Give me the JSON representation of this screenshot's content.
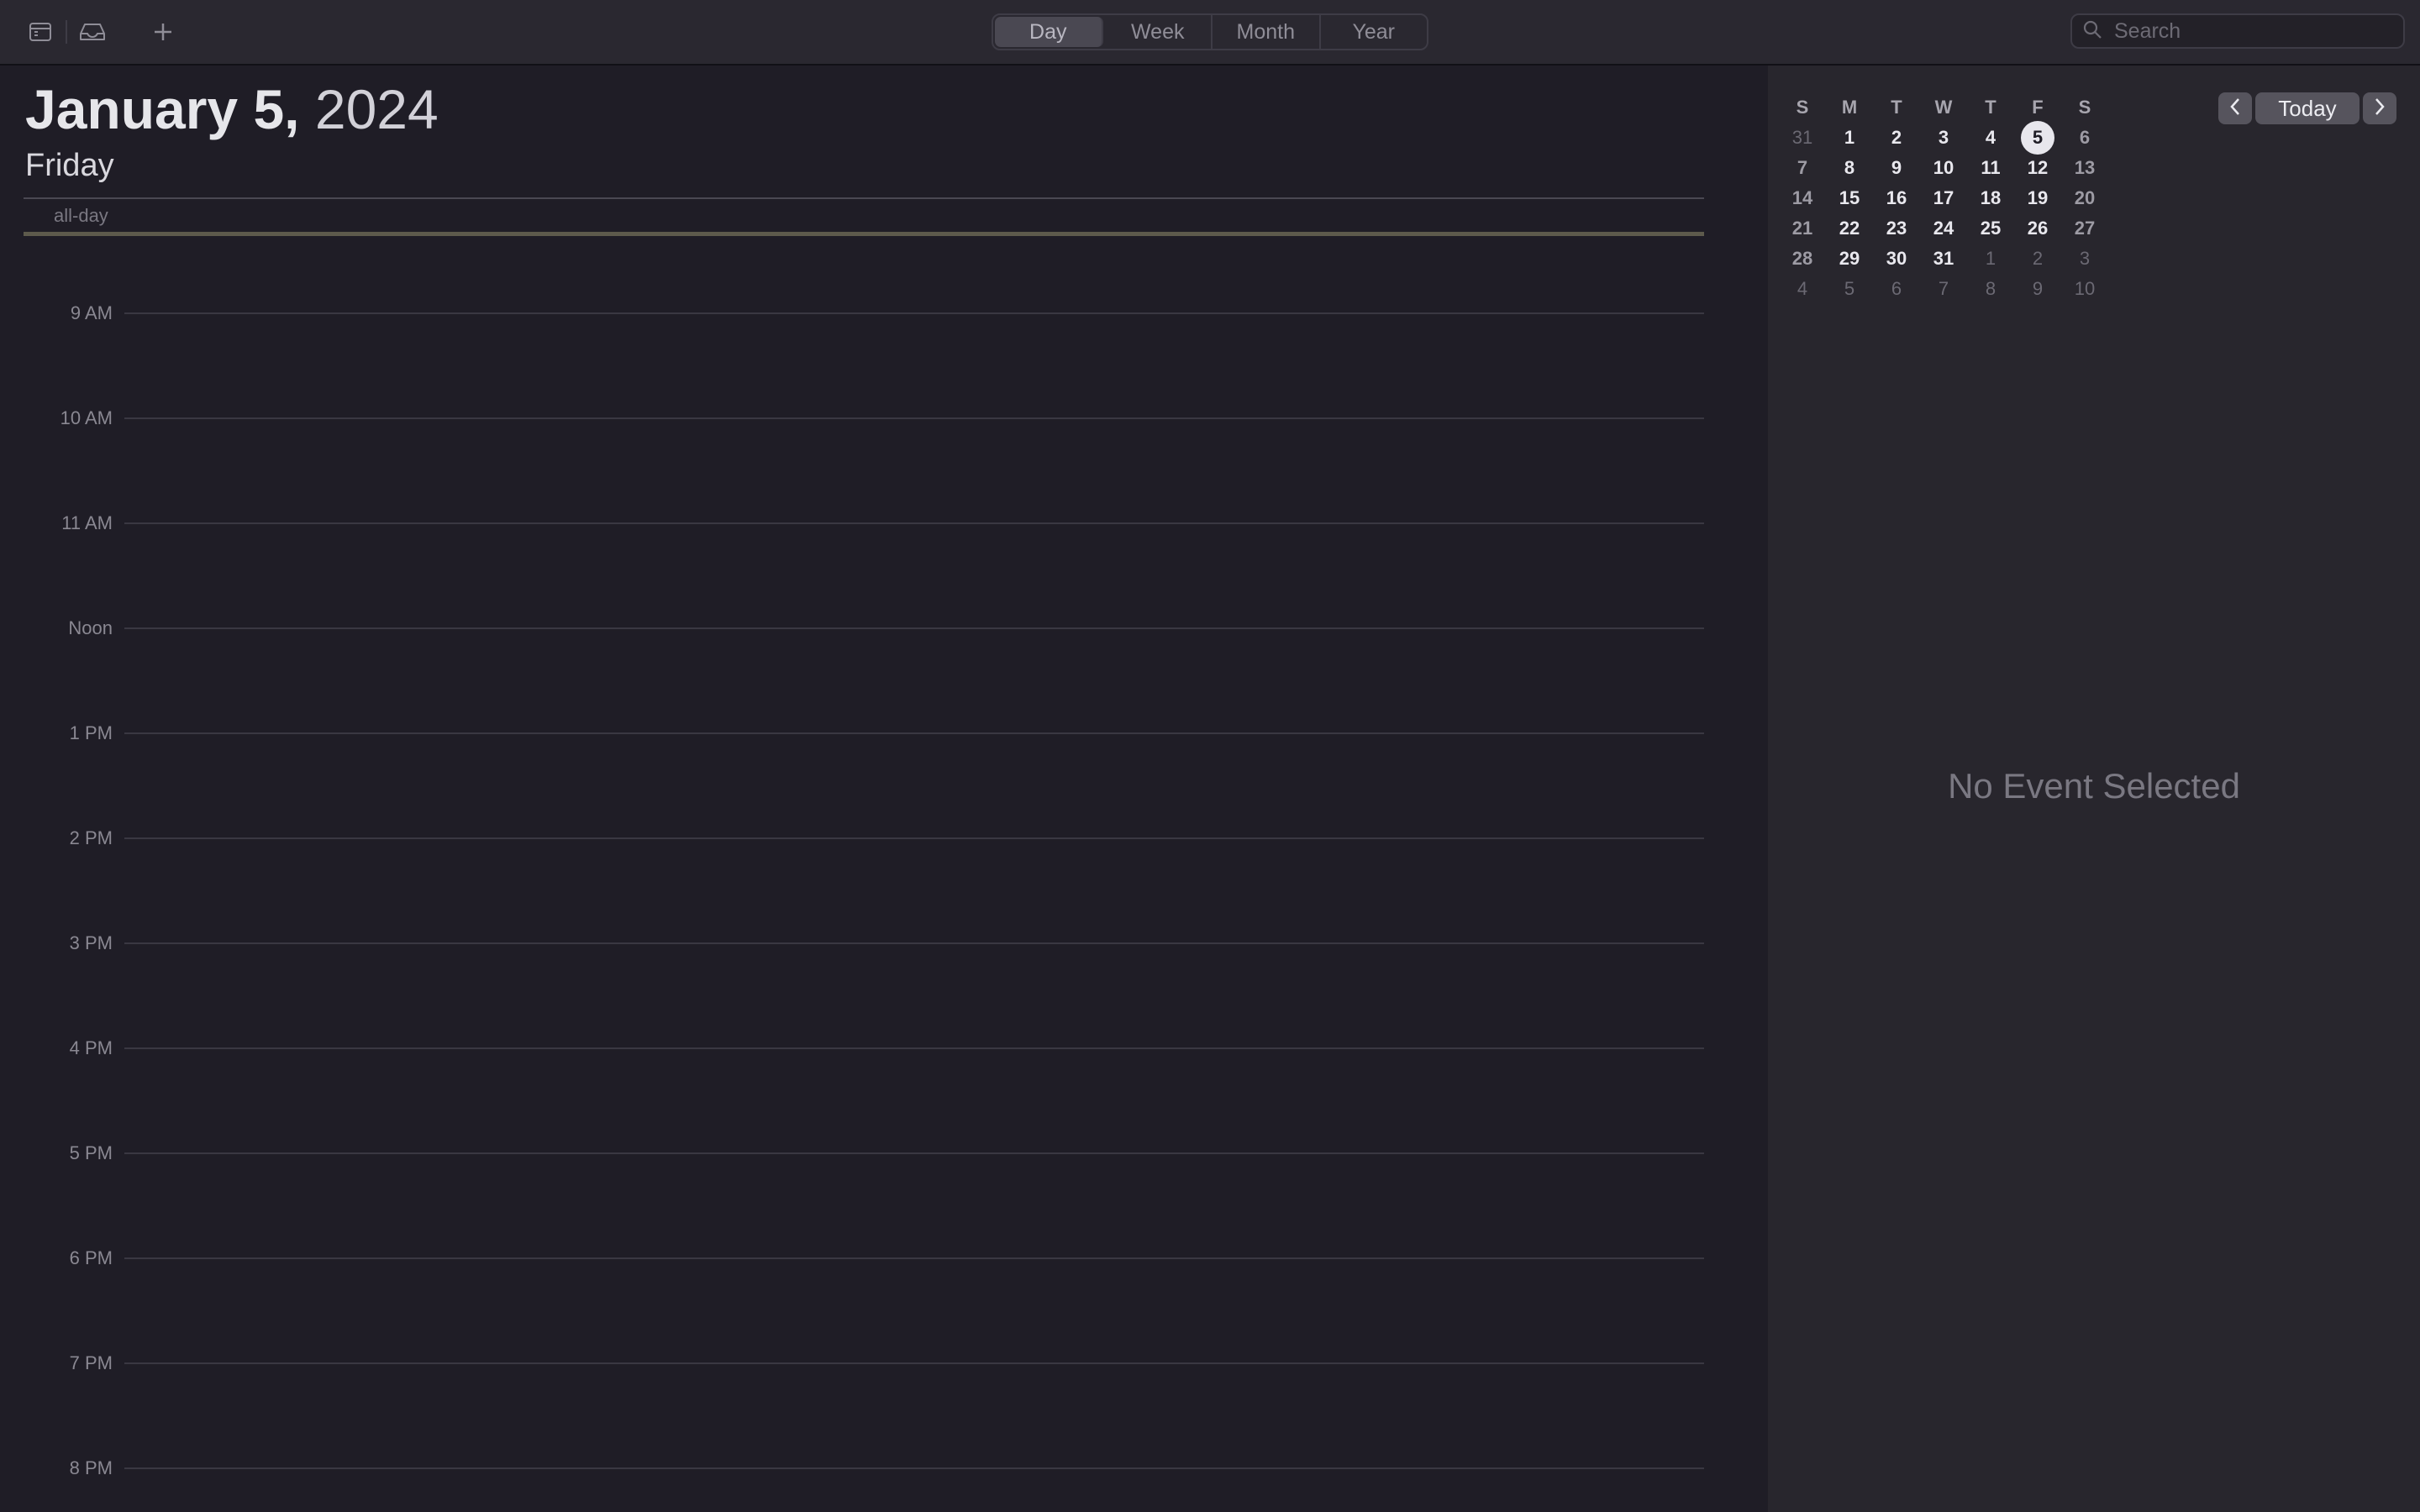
{
  "toolbar": {
    "view_tabs": [
      {
        "label": "Day",
        "active": true
      },
      {
        "label": "Week",
        "active": false
      },
      {
        "label": "Month",
        "active": false
      },
      {
        "label": "Year",
        "active": false
      }
    ],
    "search_placeholder": "Search",
    "icons": [
      "calendars-sidebar-icon",
      "inbox-icon",
      "plus-icon",
      "search-icon"
    ]
  },
  "day_view": {
    "month_day": "January 5,",
    "year": "2024",
    "weekday": "Friday",
    "all_day_label": "all-day",
    "hours": [
      "9 AM",
      "10 AM",
      "11 AM",
      "Noon",
      "1 PM",
      "2 PM",
      "3 PM",
      "4 PM",
      "5 PM",
      "6 PM",
      "7 PM",
      "8 PM"
    ]
  },
  "mini_calendar": {
    "weekday_headers": [
      "S",
      "M",
      "T",
      "W",
      "T",
      "F",
      "S"
    ],
    "weeks": [
      [
        "31",
        "1",
        "2",
        "3",
        "4",
        "5",
        "6"
      ],
      [
        "7",
        "8",
        "9",
        "10",
        "11",
        "12",
        "13"
      ],
      [
        "14",
        "15",
        "16",
        "17",
        "18",
        "19",
        "20"
      ],
      [
        "21",
        "22",
        "23",
        "24",
        "25",
        "26",
        "27"
      ],
      [
        "28",
        "29",
        "30",
        "31",
        "1",
        "2",
        "3"
      ],
      [
        "4",
        "5",
        "6",
        "7",
        "8",
        "9",
        "10"
      ]
    ],
    "selected_day": "5",
    "today_label": "Today"
  },
  "inspector": {
    "empty_text": "No Event Selected"
  },
  "colors": {
    "background": "#1f1d26",
    "sidebar": "#28262d",
    "toolbar": "#2a2830",
    "selected_day_bg": "#e8e7ed"
  }
}
